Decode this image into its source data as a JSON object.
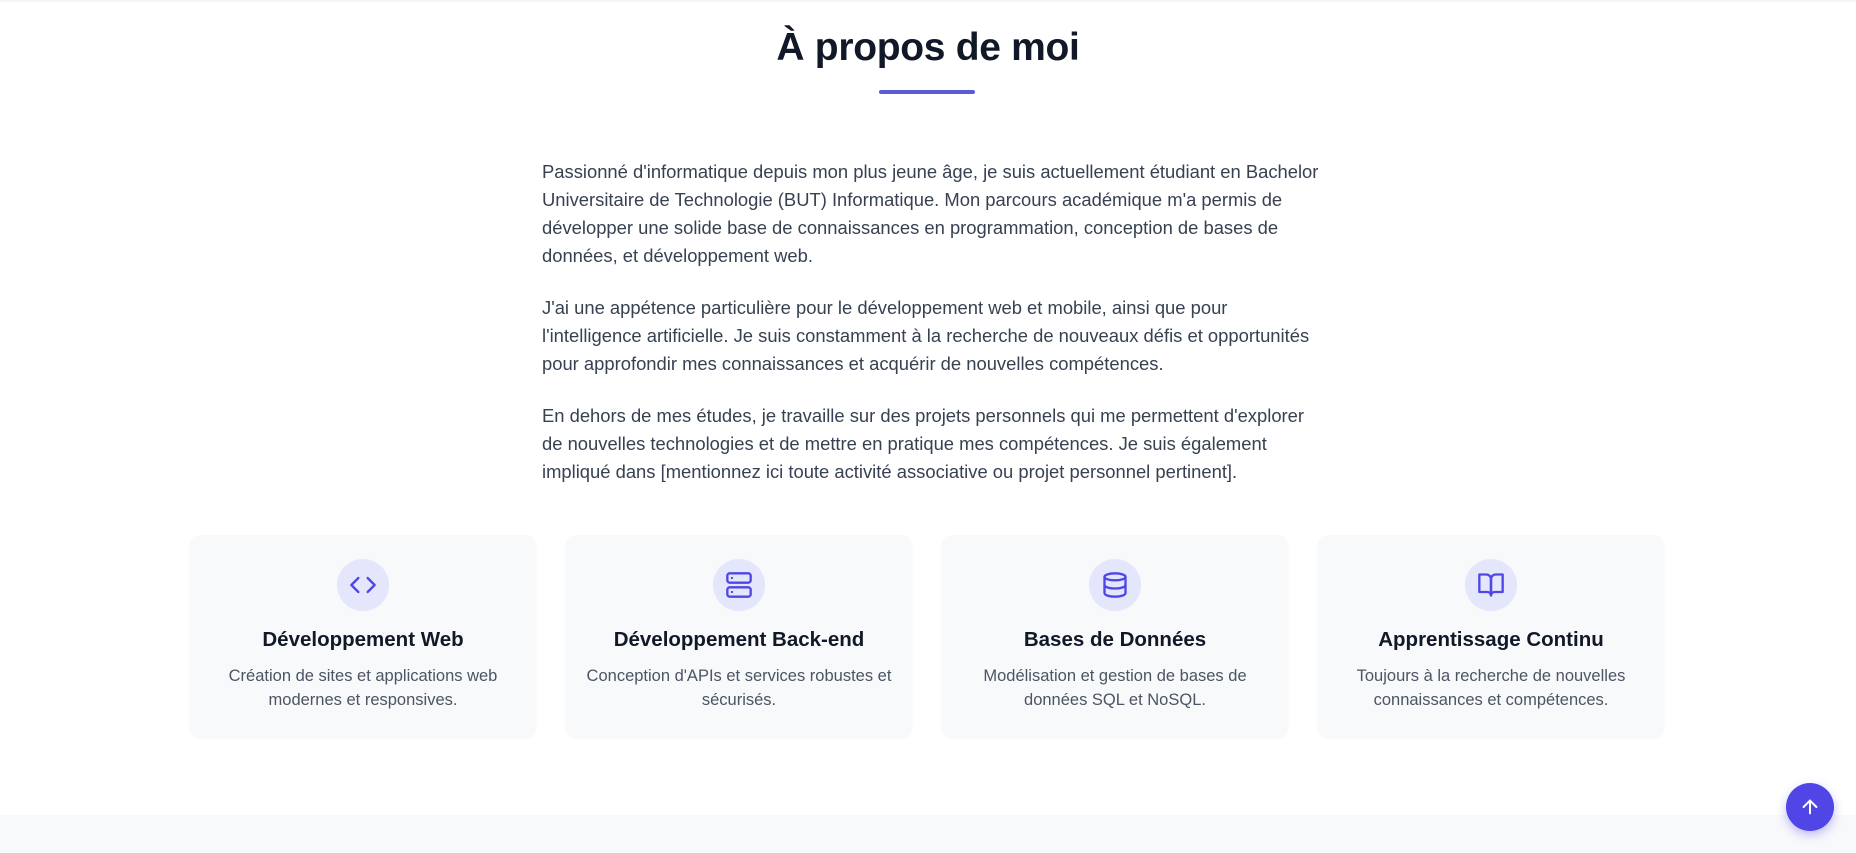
{
  "about": {
    "title": "À propos de moi",
    "paragraphs": [
      "Passionné d'informatique depuis mon plus jeune âge, je suis actuellement étudiant en Bachelor Universitaire de Technologie (BUT) Informatique. Mon parcours académique m'a permis de développer une solide base de connaissances en programmation, conception de bases de données, et développement web.",
      "J'ai une appétence particulière pour le développement web et mobile, ainsi que pour l'intelligence artificielle. Je suis constamment à la recherche de nouveaux défis et opportunités pour approfondir mes connaissances et acquérir de nouvelles compétences.",
      "En dehors de mes études, je travaille sur des projets personnels qui me permettent d'explorer de nouvelles technologies et de mettre en pratique mes compétences. Je suis également impliqué dans [mentionnez ici toute activité associative ou projet personnel pertinent]."
    ]
  },
  "cards": [
    {
      "icon": "code-icon",
      "title": "Développement Web",
      "description": "Création de sites et applications web modernes et responsives."
    },
    {
      "icon": "server-icon",
      "title": "Développement Back-end",
      "description": "Conception d'APIs et services robustes et sécurisés."
    },
    {
      "icon": "database-icon",
      "title": "Bases de Données",
      "description": "Modélisation et gestion de bases de données SQL et NoSQL."
    },
    {
      "icon": "book-open-icon",
      "title": "Apprentissage Continu",
      "description": "Toujours à la recherche de nouvelles connaissances et compétences."
    }
  ],
  "scroll_top": {
    "icon": "arrow-up-icon"
  },
  "colors": {
    "accent": "#4f46e5",
    "underline": "#5b5bd6",
    "icon_bg": "#e4e6fb",
    "card_bg": "#f8f9fb"
  }
}
